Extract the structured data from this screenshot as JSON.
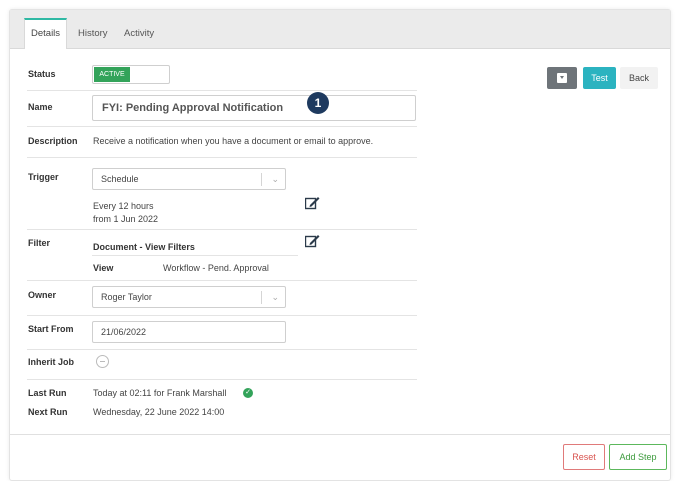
{
  "tabs": [
    {
      "label": "Details",
      "active": true
    },
    {
      "label": "History",
      "active": false
    },
    {
      "label": "Activity",
      "active": false
    }
  ],
  "status": {
    "label": "Status",
    "value": "ACTIVE"
  },
  "name": {
    "label": "Name",
    "value": "FYI: Pending Approval Notification",
    "badge": "1"
  },
  "description": {
    "label": "Description",
    "value": "Receive a notification when you have a document or email to approve."
  },
  "trigger": {
    "label": "Trigger",
    "value": "Schedule",
    "schedule_line1": "Every 12 hours",
    "schedule_line2": "from 1 Jun 2022"
  },
  "filter": {
    "label": "Filter",
    "value": "Document - View Filters",
    "view_label": "View",
    "view_value": "Workflow - Pend. Approval"
  },
  "owner": {
    "label": "Owner",
    "value": "Roger Taylor"
  },
  "start_from": {
    "label": "Start From",
    "value": "21/06/2022"
  },
  "inherit_job": {
    "label": "Inherit Job"
  },
  "last_run": {
    "label": "Last Run",
    "value": "Today at 02:11 for Frank Marshall"
  },
  "next_run": {
    "label": "Next Run",
    "value": "Wednesday, 22 June 2022 14:00"
  },
  "toolbar": {
    "test_label": "Test",
    "back_label": "Back"
  },
  "footer": {
    "reset_label": "Reset",
    "add_step_label": "Add Step"
  },
  "colors": {
    "accent": "#2bb3c0",
    "active": "#33a35a",
    "badge": "#1e3a5f",
    "reset": "#d9534f",
    "add": "#5cb85c"
  }
}
